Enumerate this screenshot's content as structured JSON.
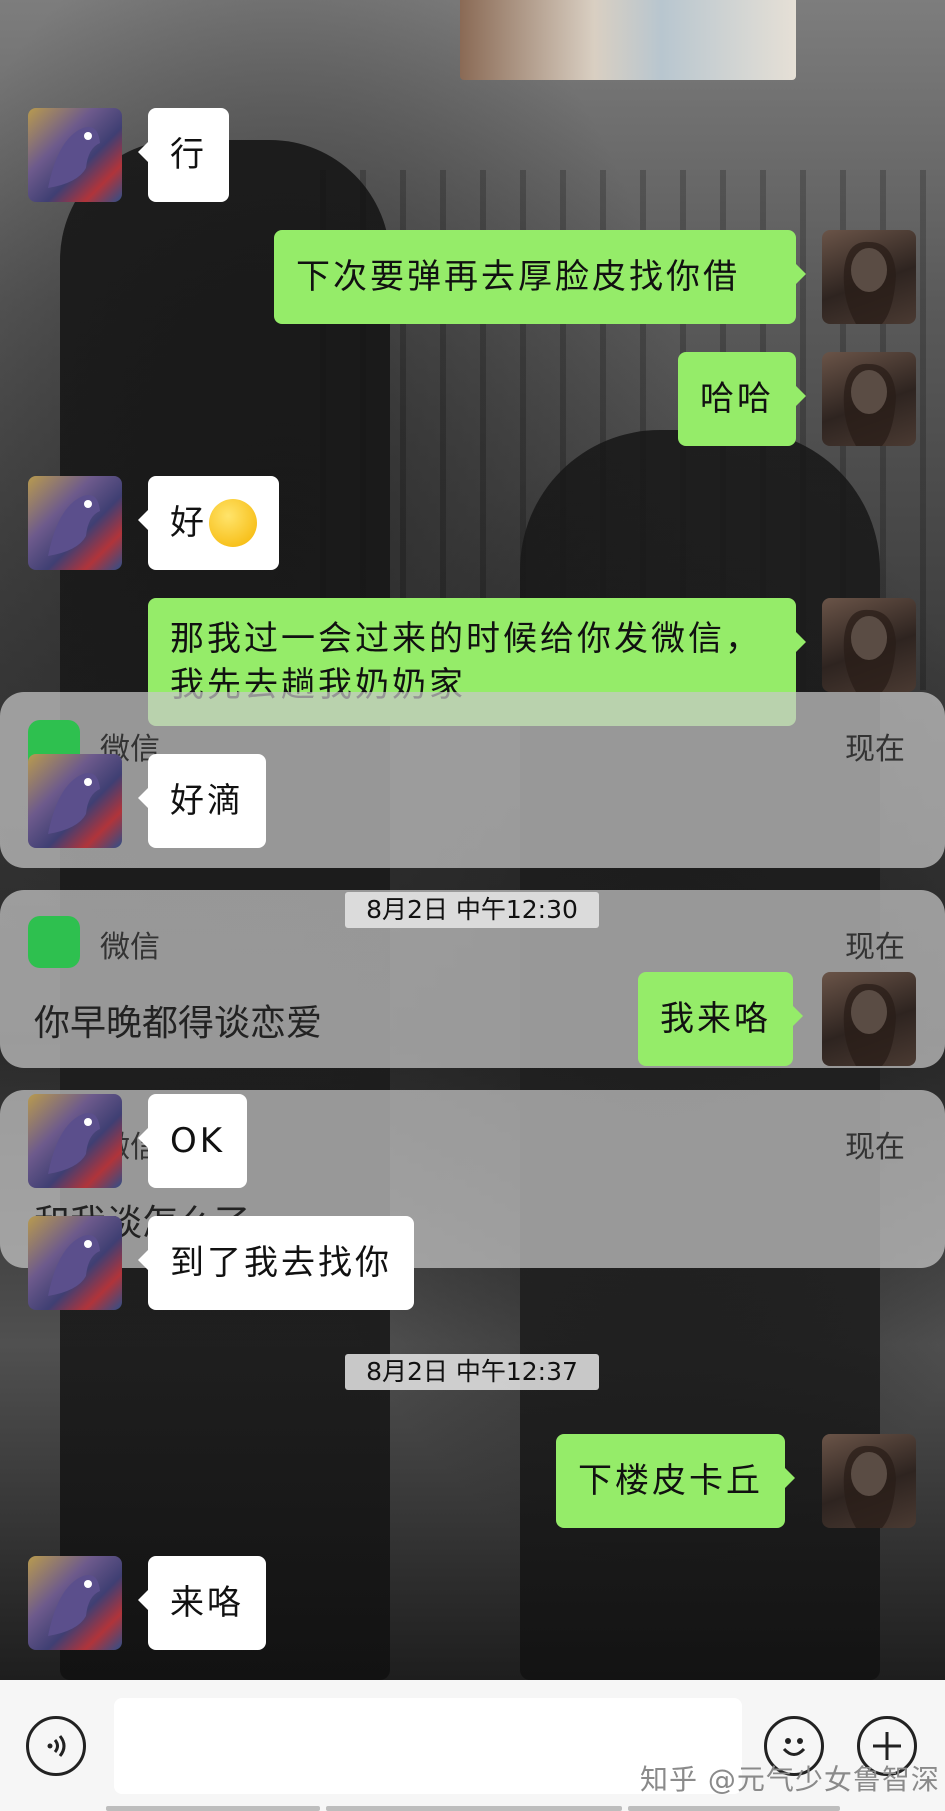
{
  "messages": [
    {
      "side": "left",
      "text": "行"
    },
    {
      "side": "right",
      "text": "下次要弹再去厚脸皮找你借"
    },
    {
      "side": "right",
      "text": "哈哈"
    },
    {
      "side": "left",
      "text": "好",
      "emoji": "smirk-emoji"
    },
    {
      "side": "right",
      "line1": "那我过一会过来的时候给你发微信，",
      "line2": "我先去趟我奶奶家"
    },
    {
      "side": "left",
      "text": "好滴"
    },
    {
      "side": "right",
      "text": "我来咯"
    },
    {
      "side": "left",
      "text": "OK"
    },
    {
      "side": "left",
      "text": "到了我去找你"
    },
    {
      "side": "right",
      "text": "下楼皮卡丘"
    },
    {
      "side": "left",
      "text": "来咯"
    }
  ],
  "timestamps": [
    "8月2日 中午12:30",
    "8月2日 中午12:37"
  ],
  "notifications": [
    {
      "app": "微信",
      "time": "现在",
      "message": ""
    },
    {
      "app": "微信",
      "time": "现在",
      "message": "你早晚都得谈恋爱"
    },
    {
      "app": "微信",
      "time": "现在",
      "message": "和我谈怎么了"
    }
  ],
  "input": {
    "placeholder": ""
  },
  "watermark": "知乎 @元气少女鲁智深",
  "icons": {
    "voice": "voice-icon",
    "emoji": "emoji-icon",
    "plus": "plus-icon"
  }
}
